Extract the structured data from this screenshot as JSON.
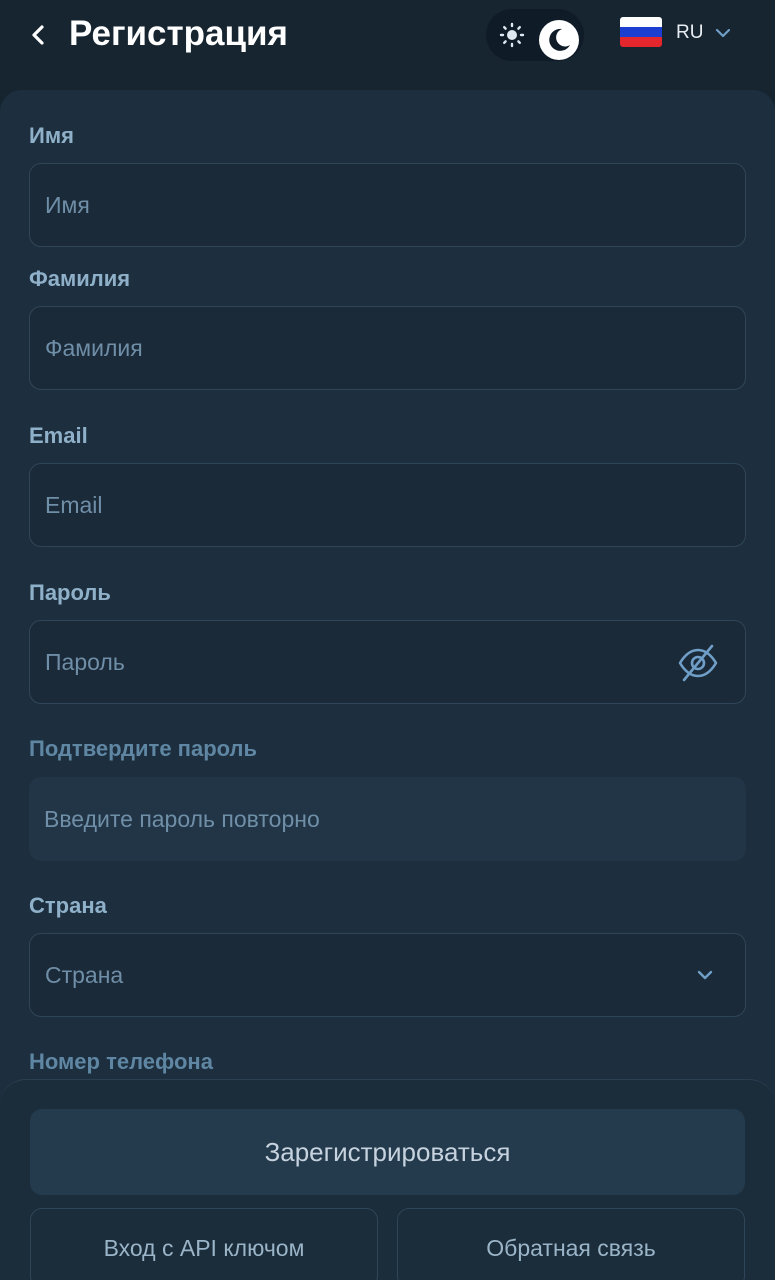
{
  "header": {
    "title": "Регистрация",
    "language": "RU",
    "flag_colors": [
      "#ffffff",
      "#1c3fd1",
      "#e5262d"
    ]
  },
  "form": {
    "first_name": {
      "label": "Имя",
      "placeholder": "Имя",
      "value": ""
    },
    "last_name": {
      "label": "Фамилия",
      "placeholder": "Фамилия",
      "value": ""
    },
    "email": {
      "label": "Email",
      "placeholder": "Email",
      "value": ""
    },
    "password": {
      "label": "Пароль",
      "placeholder": "Пароль",
      "value": ""
    },
    "confirm_password": {
      "label": "Подтвердите пароль",
      "placeholder": "Введите пароль повторно",
      "value": ""
    },
    "country": {
      "label": "Страна",
      "selected": "Страна"
    },
    "phone": {
      "label": "Номер телефона"
    }
  },
  "actions": {
    "register_label": "Зарегистрироваться",
    "api_login_label": "Вход с API ключом",
    "feedback_label": "Обратная связь"
  },
  "icons": {
    "back": "chevron-left-icon",
    "sun": "sun-icon",
    "moon": "moon-icon",
    "lang_chevron": "chevron-down-icon",
    "eye": "eye-off-icon",
    "select_chevron": "chevron-down-icon"
  },
  "colors": {
    "background": "#162430",
    "card": "#1d2f3e",
    "label": "#8fb0c9",
    "placeholder": "#6f8ea7",
    "button": "#243a4d"
  }
}
